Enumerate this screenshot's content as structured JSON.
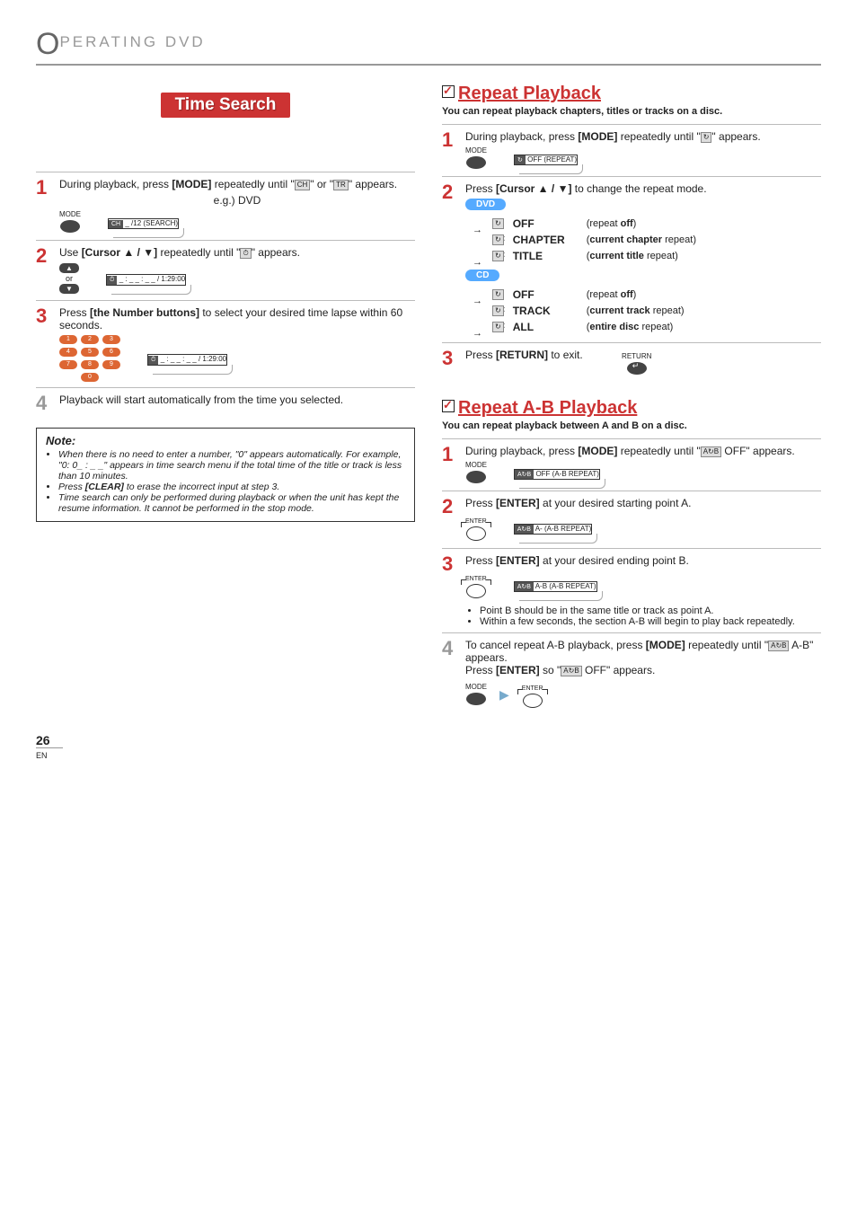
{
  "header": {
    "big_letter": "O",
    "title": "PERATING  DVD"
  },
  "left": {
    "time_search_title": "Time Search",
    "step1": {
      "text_a": "During playback, press ",
      "bold": "[MODE]",
      "text_b": " repeatedly until \"",
      "chip1": "CH",
      "text_c": "\" or \"",
      "chip2": "TR",
      "text_d": "\" appears.",
      "eg": "e.g.) DVD",
      "mode_label": "MODE",
      "osd": "_ /12 (SEARCH)"
    },
    "step2": {
      "text_a": "Use ",
      "bold": "[Cursor ▲ / ▼]",
      "text_b": " repeatedly until \"",
      "chip": "⏱",
      "text_c": "\" appears.",
      "or": "or",
      "osd": "_ : _ _ : _ _   /   1:29:00"
    },
    "step3": {
      "text_a": "Press ",
      "bold": "[the Number buttons]",
      "text_b": " to select your desired time lapse within 60 seconds.",
      "osd": "_ : _ _ : _ _   /   1:29:00"
    },
    "step4": {
      "text": "Playback will start automatically from the time you selected."
    },
    "note": {
      "title": "Note:",
      "items": [
        "When there is no need to enter a number, \"0\" appears automatically. For example, \"0: 0_ : _ _\" appears in time search menu if the total time of the title or track is less than 10 minutes.",
        "Press [CLEAR] to erase the incorrect input at step 3.",
        "Time search can only be performed during playback or when the unit has kept the resume information. It cannot be performed in the stop mode."
      ]
    }
  },
  "right": {
    "repeat": {
      "title": "Repeat Playback",
      "sub": "You can repeat playback chapters, titles or tracks on a disc.",
      "step1": {
        "text_a": "During playback, press ",
        "bold": "[MODE]",
        "text_b": " repeatedly until \"",
        "chip": "↻",
        "text_c": "\" appears.",
        "mode_label": "MODE",
        "osd": "OFF   (REPEAT)"
      },
      "step2": {
        "text_a": "Press ",
        "bold": "[Cursor ▲ / ▼]",
        "text_b": " to change the repeat mode.",
        "dvd_pill": "DVD",
        "dvd_modes": [
          {
            "label": "OFF",
            "desc_a": "(repeat ",
            "desc_b": "off",
            "desc_c": ")"
          },
          {
            "label": "CHAPTER",
            "desc_a": "(",
            "desc_b": "current chapter",
            "desc_c": " repeat)"
          },
          {
            "label": "TITLE",
            "desc_a": "(",
            "desc_b": "current title",
            "desc_c": " repeat)"
          }
        ],
        "cd_pill": "CD",
        "cd_modes": [
          {
            "label": "OFF",
            "desc_a": "(repeat ",
            "desc_b": "off",
            "desc_c": ")"
          },
          {
            "label": "TRACK",
            "desc_a": "(",
            "desc_b": "current track",
            "desc_c": " repeat)"
          },
          {
            "label": "ALL",
            "desc_a": "(",
            "desc_b": "entire disc",
            "desc_c": " repeat)"
          }
        ]
      },
      "step3": {
        "text_a": "Press ",
        "bold": "[RETURN]",
        "text_b": " to exit.",
        "return_label": "RETURN"
      }
    },
    "repeat_ab": {
      "title": "Repeat A-B Playback",
      "sub": "You can repeat playback between A and B on a disc.",
      "step1": {
        "text_a": "During playback, press ",
        "bold": "[MODE]",
        "text_b": " repeatedly until \"",
        "chip": "A↻B",
        "text_c": " OFF\" appears.",
        "mode_label": "MODE",
        "osd": "OFF (A-B REPEAT)"
      },
      "step2": {
        "text_a": "Press ",
        "bold": "[ENTER]",
        "text_b": " at your desired starting point A.",
        "enter_label": "ENTER",
        "osd": "A-    (A-B REPEAT)"
      },
      "step3": {
        "text_a": "Press ",
        "bold": "[ENTER]",
        "text_b": " at your desired ending point B.",
        "enter_label": "ENTER",
        "osd": "A-B (A-B REPEAT)",
        "bullets": [
          "Point B should be in the same title or track as point A.",
          "Within a few seconds, the section A-B will begin to play back repeatedly."
        ]
      },
      "step4": {
        "text_a": "To cancel repeat A-B playback, press ",
        "bold1": "[MODE]",
        "text_b": " repeatedly until \"",
        "chip1": "A↻B",
        "text_c": " A-B\" appears.",
        "text_d": "Press ",
        "bold2": "[ENTER]",
        "text_e": " so \"",
        "chip2": "A↻B",
        "text_f": " OFF\" appears.",
        "mode_label": "MODE",
        "enter_label": "ENTER"
      }
    }
  },
  "footer": {
    "page": "26",
    "lang": "EN"
  }
}
